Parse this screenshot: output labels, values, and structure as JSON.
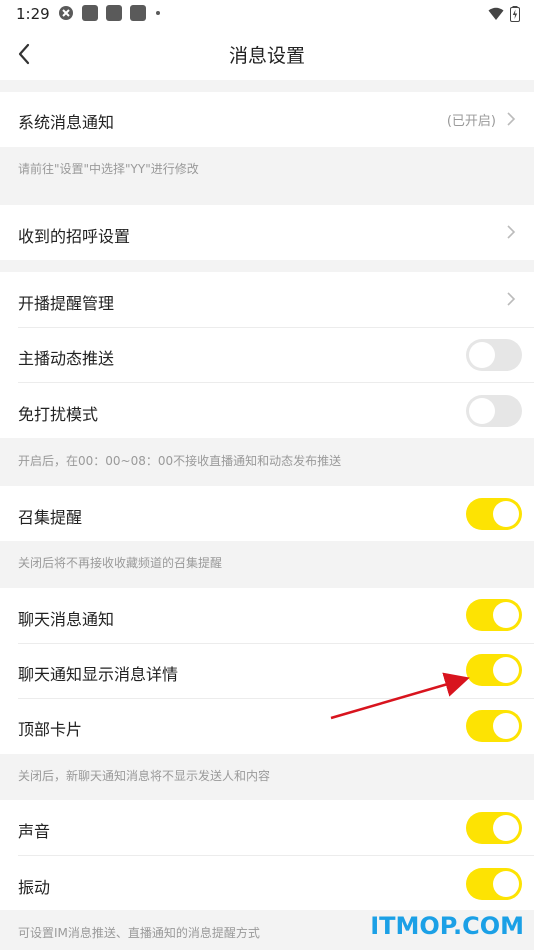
{
  "status_bar": {
    "time": "1:29"
  },
  "header": {
    "title": "消息设置"
  },
  "sections": {
    "system": {
      "label": "系统消息通知",
      "status": "(已开启)",
      "hint": "请前往\"设置\"中选择\"YY\"进行修改"
    },
    "greeting": {
      "label": "收到的招呼设置"
    },
    "live": {
      "reminder_label": "开播提醒管理",
      "anchor_push_label": "主播动态推送",
      "anchor_push_on": false,
      "dnd_label": "免打扰模式",
      "dnd_on": false,
      "hint": "开启后，在00：00~08：00不接收直播通知和动态发布推送"
    },
    "gather": {
      "label": "召集提醒",
      "on": true,
      "hint": "关闭后将不再接收收藏频道的召集提醒"
    },
    "chat": {
      "notify_label": "聊天消息通知",
      "notify_on": true,
      "detail_label": "聊天通知显示消息详情",
      "detail_on": true,
      "top_card_label": "顶部卡片",
      "top_card_on": true,
      "hint": "关闭后，新聊天通知消息将不显示发送人和内容"
    },
    "alert": {
      "sound_label": "声音",
      "sound_on": true,
      "vibrate_label": "振动",
      "vibrate_on": true,
      "hint": "可设置IM消息推送、直播通知的消息提醒方式"
    }
  },
  "watermark": "ITMOP.COM",
  "colors": {
    "toggle_on": "#fde303",
    "toggle_off": "#e6e6e6",
    "annotation_arrow": "#d8141e",
    "watermark": "#1ba0e6"
  }
}
